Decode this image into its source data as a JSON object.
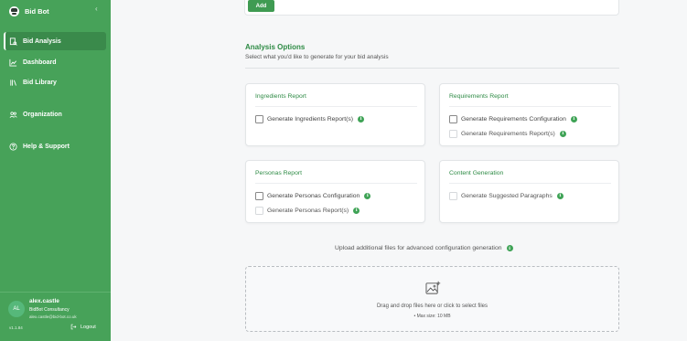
{
  "app": {
    "name": "Bid Bot",
    "collapse_icon": "‹"
  },
  "sidebar": {
    "items": [
      {
        "label": "Bid Analysis",
        "icon": "document-search-icon",
        "active": true
      },
      {
        "label": "Dashboard",
        "icon": "chart-line-icon",
        "active": false
      },
      {
        "label": "Bid Library",
        "icon": "library-icon",
        "active": false
      },
      {
        "label": "Organization",
        "icon": "people-icon",
        "active": false
      },
      {
        "label": "Help & Support",
        "icon": "help-circle-icon",
        "active": false
      }
    ],
    "user": {
      "initials": "AL",
      "name": "alex.castle",
      "org": "BidBot Consultancy",
      "email": "alex.castle@bid-bot.co.uk"
    },
    "version": "v1.1.84",
    "logout_label": "Logout"
  },
  "main": {
    "add_label": "Add",
    "section": {
      "title": "Analysis Options",
      "subtitle": "Select what you'd like to generate for your bid analysis"
    },
    "cards": [
      {
        "title": "Ingredients Report",
        "options": [
          {
            "label": "Generate Ingredients Report(s)",
            "checked": false,
            "disabled": false
          }
        ]
      },
      {
        "title": "Requirements Report",
        "options": [
          {
            "label": "Generate Requirements Configuration",
            "checked": false,
            "disabled": false
          },
          {
            "label": "Generate Requirements Report(s)",
            "checked": false,
            "disabled": true
          }
        ]
      },
      {
        "title": "Personas Report",
        "options": [
          {
            "label": "Generate Personas Configuration",
            "checked": false,
            "disabled": false
          },
          {
            "label": "Generate Personas Report(s)",
            "checked": false,
            "disabled": true
          }
        ]
      },
      {
        "title": "Content Generation",
        "options": [
          {
            "label": "Generate Suggested Paragraphs",
            "checked": false,
            "disabled": true
          }
        ]
      }
    ],
    "upload": {
      "label": "Upload additional files for advanced configuration generation",
      "drop_text": "Drag and drop files here or click to select files",
      "max_size": "• Max size: 10 MB"
    }
  },
  "colors": {
    "sidebar": "#47a259",
    "accent": "#2e8b45",
    "button": "#3f9b52"
  }
}
